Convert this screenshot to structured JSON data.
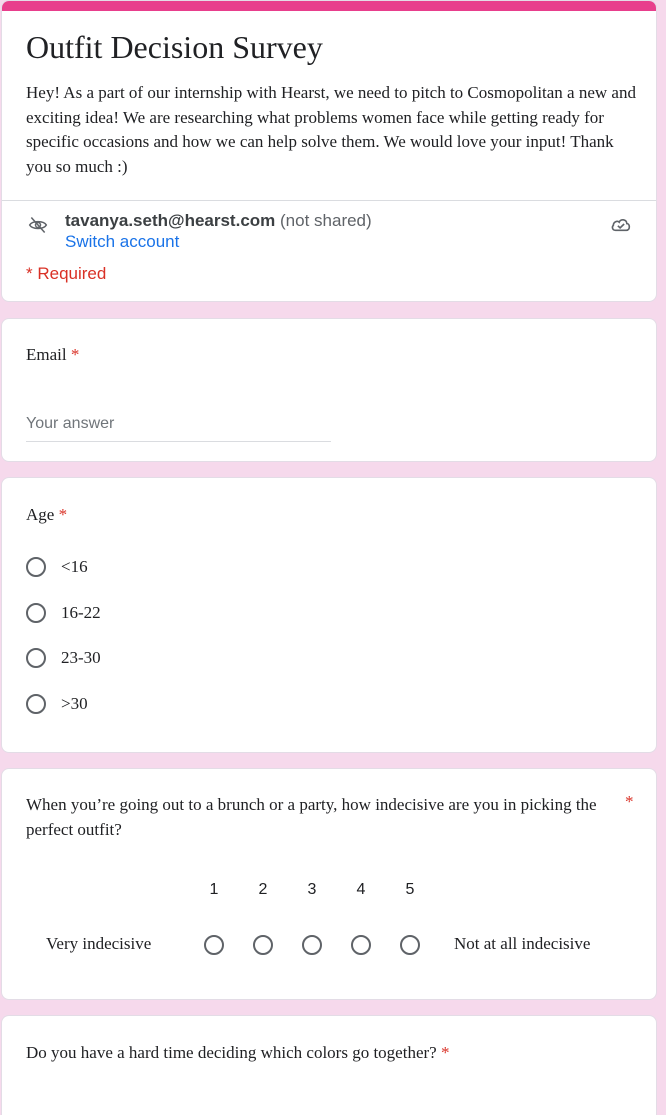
{
  "form": {
    "title": "Outfit Decision Survey",
    "description": "Hey! As a part of our internship with Hearst, we need to pitch to Cosmopolitan a new and exciting idea! We are researching what problems women face while getting ready for specific occasions and how we can help solve them. We would love your input! Thank you so much :)",
    "accent_color": "#e83e8c",
    "background_color": "#f6d9ec"
  },
  "account": {
    "email": "tavanya.seth@hearst.com",
    "not_shared": "(not shared)",
    "switch_label": "Switch account",
    "icons": [
      "eye-off-icon",
      "cloud-check-icon"
    ]
  },
  "required_note": "* Required",
  "email_question": {
    "label": "Email",
    "required_mark": "*",
    "placeholder": "Your answer"
  },
  "age_question": {
    "label": "Age",
    "required_mark": "*",
    "options": [
      "<16",
      "16-22",
      "23-30",
      ">30"
    ]
  },
  "indecisive_question": {
    "label": "When you’re going out to a brunch or a party, how indecisive are you in picking the perfect outfit?",
    "required_mark": "*",
    "scale": [
      "1",
      "2",
      "3",
      "4",
      "5"
    ],
    "low_label": "Very indecisive",
    "high_label": "Not at all indecisive"
  },
  "colors_question": {
    "label": "Do you have a hard time deciding which colors go together?",
    "required_mark": "*"
  }
}
